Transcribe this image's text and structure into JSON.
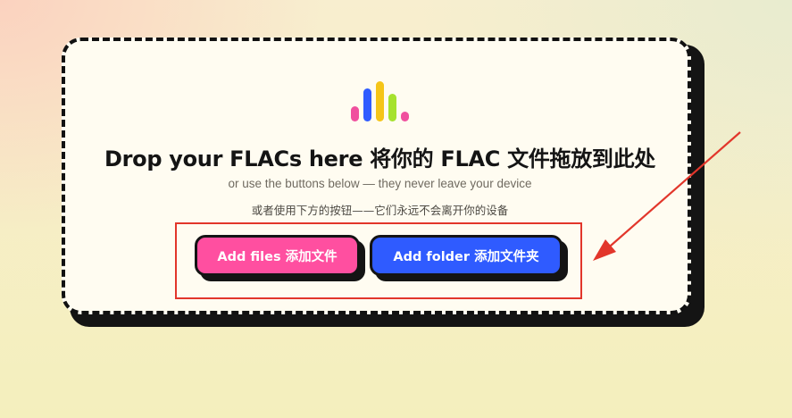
{
  "dropzone": {
    "title": "Drop your FLACs here 将你的 FLAC 文件拖放到此处",
    "subtitle_en": "or use the buttons below — they never leave your device",
    "subtitle_zh": "或者使用下方的按钮——它们永远不会离开你的设备",
    "logo_icon": "audio-bars-icon",
    "bar_colors": [
      "#f0509e",
      "#2f5bff",
      "#f5c518",
      "#a6e22e",
      "#f0509e"
    ]
  },
  "buttons": {
    "add_files_label": "Add files 添加文件",
    "add_files_color": "#ff4fa0",
    "add_folder_label": "Add folder 添加文件夹",
    "add_folder_color": "#2f5bff"
  },
  "annotation": {
    "highlight_color": "#e2362b"
  }
}
